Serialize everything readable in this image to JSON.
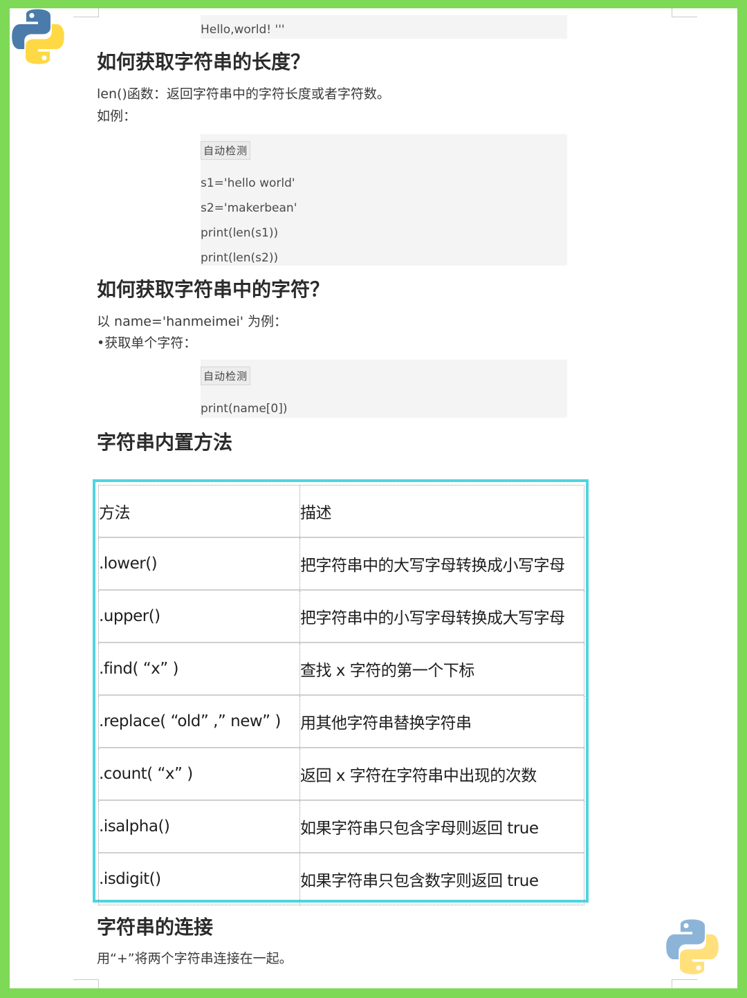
{
  "top_code": {
    "line": "Hello,world! '''"
  },
  "section_length": {
    "heading": "如何获取字符串的长度？",
    "desc": "len()函数：返回字符串中的字符长度或者字符数。",
    "example_label": "如例：",
    "code_tag": "自动检测",
    "code_lines": [
      "s1='hello world'",
      "s2='makerbean'",
      "print(len(s1))",
      "print(len(s2))"
    ]
  },
  "section_char": {
    "heading": "如何获取字符串中的字符？",
    "desc": "以 name='hanmeimei' 为例：",
    "bullet": "•获取单个字符：",
    "code_tag": "自动检测",
    "code_lines": [
      "print(name[0])"
    ]
  },
  "section_methods": {
    "heading": "字符串内置方法",
    "table": {
      "headers": [
        "方法",
        "描述"
      ],
      "rows": [
        [
          ".lower()",
          "把字符串中的大写字母转换成小写字母"
        ],
        [
          ".upper()",
          "把字符串中的小写字母转换成大写字母"
        ],
        [
          ".find( “x” )",
          "查找 x 字符的第一个下标"
        ],
        [
          ".replace( “old” ,” new” )",
          "用其他字符串替换字符串"
        ],
        [
          ".count( “x” )",
          "返回 x 字符在字符串中出现的次数"
        ],
        [
          ".isalpha()",
          "如果字符串只包含字母则返回 true"
        ],
        [
          ".isdigit()",
          "如果字符串只包含数字则返回 true"
        ]
      ]
    }
  },
  "section_concat": {
    "heading": "字符串的连接",
    "desc": "用“+”将两个字符串连接在一起。"
  },
  "colors": {
    "background": "#7ed957",
    "table_border": "#4fd4e0",
    "python_blue": "#4b7bab",
    "python_yellow": "#ffd845"
  },
  "icons": [
    "python-logo-icon",
    "python-logo-icon"
  ]
}
